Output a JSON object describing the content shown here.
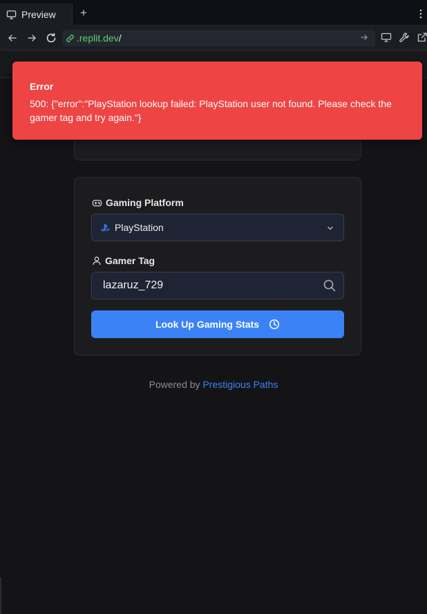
{
  "browser": {
    "tab_label": "Preview",
    "new_tab_symbol": "+",
    "url_domain": ".replit.dev",
    "url_path": "/"
  },
  "toast": {
    "title": "Error",
    "message": "500: {\"error\":\"PlayStation lookup failed: PlayStation user not found. Please check the gamer tag and try again.\"}",
    "color": "#ef4444"
  },
  "form": {
    "platform_label": "Gaming Platform",
    "platform_value": "PlayStation",
    "gamer_tag_label": "Gamer Tag",
    "gamer_tag_value": "lazaruz_729",
    "submit_label": "Look Up Gaming Stats",
    "accent": "#3b82f6"
  },
  "footer": {
    "prefix": "Powered by ",
    "link_text": "Prestigious Paths"
  },
  "icons": {
    "tab": "monitor-icon",
    "back": "arrow-left-icon",
    "forward": "arrow-right-icon",
    "reload": "reload-icon",
    "link": "link-icon",
    "go": "arrow-right-icon",
    "devices": "monitor-icon",
    "devtools": "wrench-icon",
    "external": "external-link-icon",
    "platform": "gamepad-icon",
    "playstation": "playstation-icon",
    "select": "chevron-down-icon",
    "user": "user-icon",
    "search": "search-icon",
    "submit": "clock-icon"
  }
}
